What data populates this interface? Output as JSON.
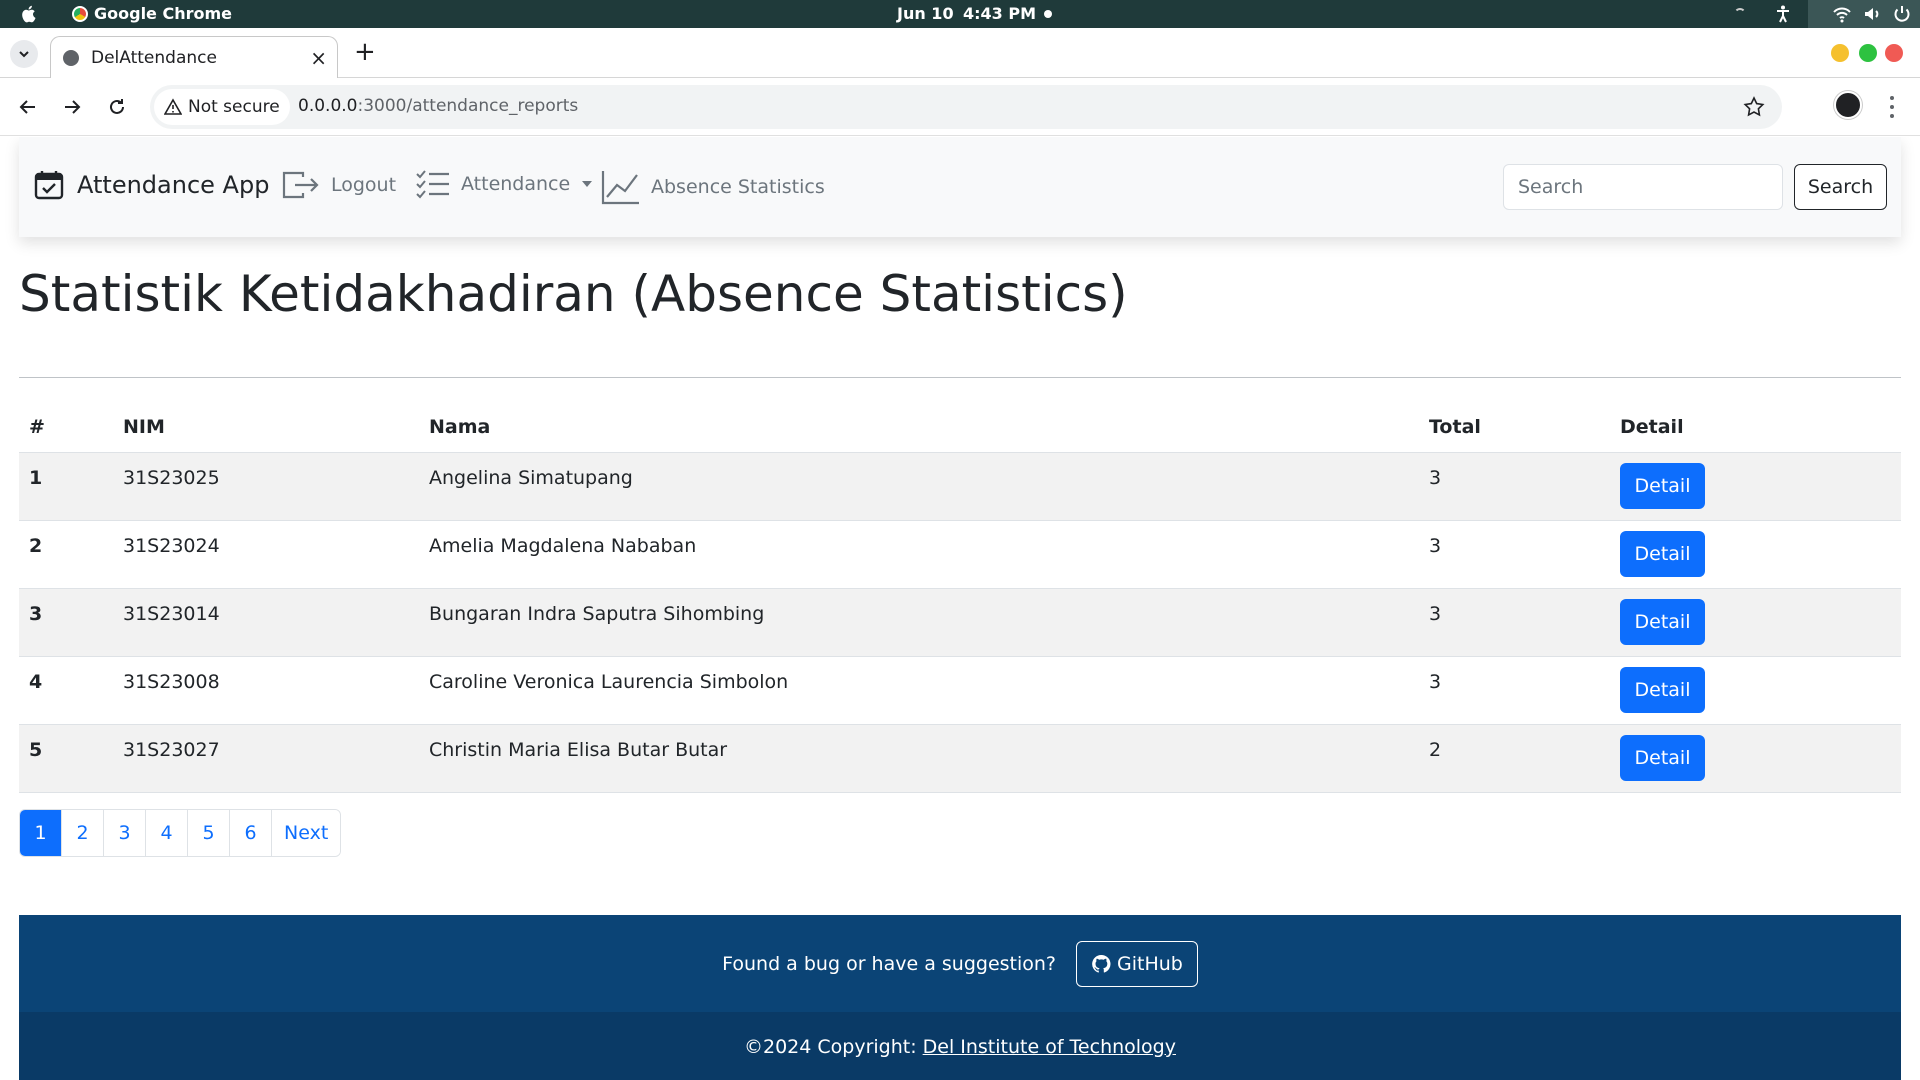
{
  "os_bar": {
    "app_name": "Google Chrome",
    "date": "Jun 10",
    "time": "4:43 PM"
  },
  "browser": {
    "tab_title": "DelAttendance",
    "security_label": "Not secure",
    "url_host": "0.0.0.0",
    "url_path": ":3000/attendance_reports"
  },
  "navbar": {
    "brand": "Attendance App",
    "logout": "Logout",
    "attendance": "Attendance",
    "absence_statistics": "Absence Statistics",
    "search_placeholder": "Search",
    "search_button": "Search"
  },
  "page": {
    "title": "Statistik Ketidakhadiran (Absence Statistics)"
  },
  "table": {
    "headers": [
      "#",
      "NIM",
      "Nama",
      "Total",
      "Detail"
    ],
    "rows": [
      {
        "index": "1",
        "nim": "31S23025",
        "nama": "Angelina Simatupang",
        "total": "3",
        "detail": "Detail"
      },
      {
        "index": "2",
        "nim": "31S23024",
        "nama": "Amelia Magdalena Nababan",
        "total": "3",
        "detail": "Detail"
      },
      {
        "index": "3",
        "nim": "31S23014",
        "nama": "Bungaran Indra Saputra Sihombing",
        "total": "3",
        "detail": "Detail"
      },
      {
        "index": "4",
        "nim": "31S23008",
        "nama": "Caroline Veronica Laurencia Simbolon",
        "total": "3",
        "detail": "Detail"
      },
      {
        "index": "5",
        "nim": "31S23027",
        "nama": "Christin Maria Elisa Butar Butar",
        "total": "2",
        "detail": "Detail"
      }
    ]
  },
  "pagination": {
    "pages": [
      "1",
      "2",
      "3",
      "4",
      "5",
      "6"
    ],
    "next": "Next",
    "active": "1"
  },
  "footer": {
    "prompt": "Found a bug or have a suggestion?",
    "github": "GitHub",
    "copyright_prefix": "©2024 Copyright:",
    "copyright_link": "Del Institute of Technology"
  },
  "colors": {
    "primary": "#0d6efd",
    "footer_top": "#0b4476",
    "footer_bottom": "#0a3a66",
    "os_bar": "#1f3a3a"
  }
}
